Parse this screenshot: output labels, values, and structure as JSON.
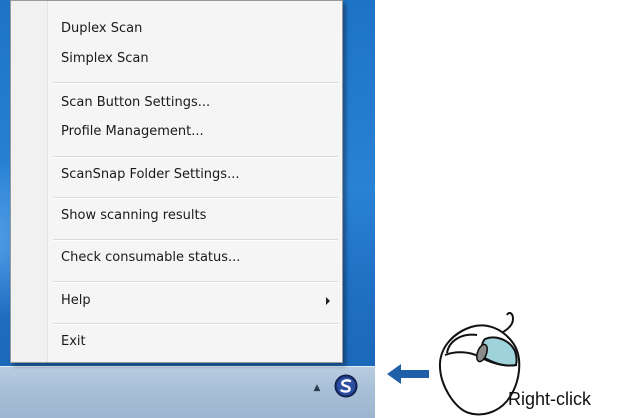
{
  "menu": {
    "items": [
      {
        "label": "Duplex Scan"
      },
      {
        "label": "Simplex Scan"
      },
      {
        "label": "Scan Button Settings..."
      },
      {
        "label": "Profile Management..."
      },
      {
        "label": "ScanSnap Folder Settings..."
      },
      {
        "label": "Show scanning results"
      },
      {
        "label": "Check consumable status..."
      },
      {
        "label": "Help",
        "has_submenu": true
      },
      {
        "label": "Exit"
      }
    ]
  },
  "tray": {
    "overflow_icon": "up-triangle-icon",
    "app_icon": "scansnap-manager-icon"
  },
  "annotation": {
    "arrow_icon": "left-arrow-icon",
    "mouse_icon": "mouse-right-button-icon",
    "caption": "Right-click"
  },
  "colors": {
    "desktop_blue": "#1e73c6",
    "mouse_button_highlight": "#9fd3dc",
    "arrow_blue": "#1f5fa8"
  }
}
